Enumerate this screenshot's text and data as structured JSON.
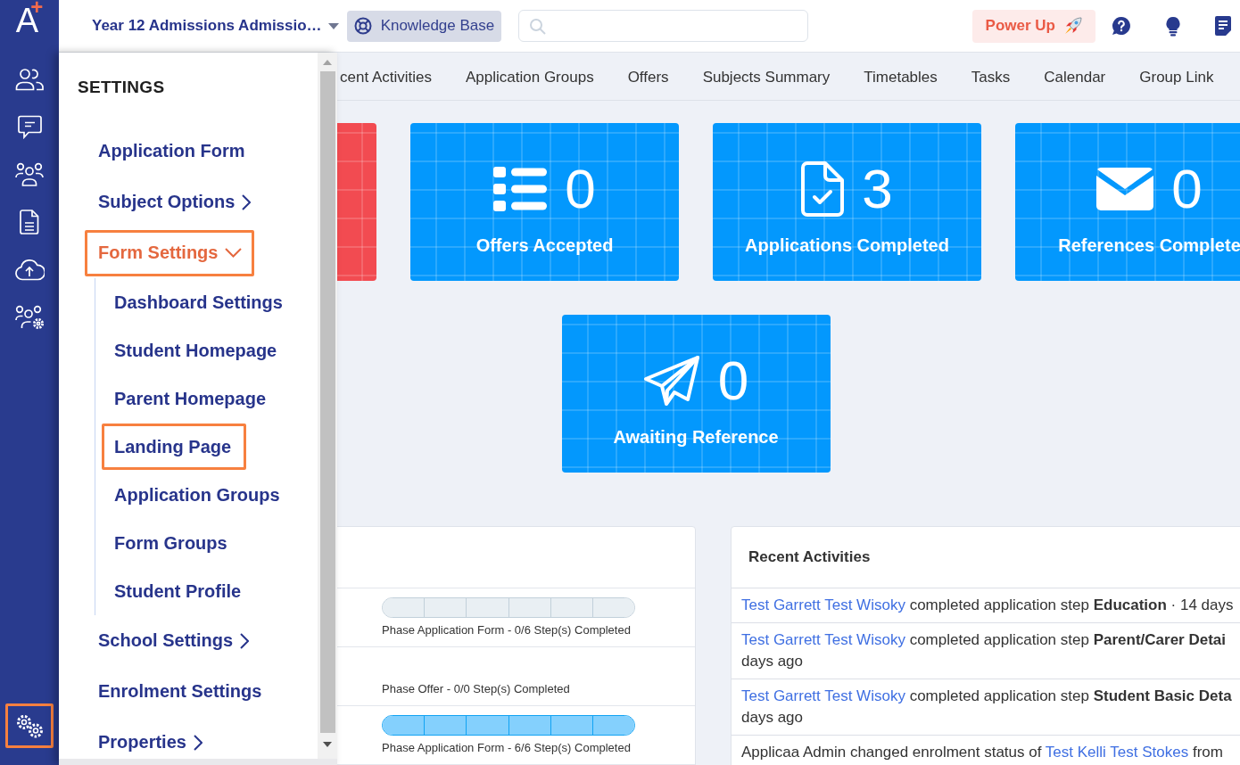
{
  "logo": {
    "letter": "A",
    "sup": "+"
  },
  "sidebar": {
    "settings_highlighted": true
  },
  "topbar": {
    "title": "Year 12 Admissions Admissio…",
    "knowledge_base": "Knowledge Base",
    "power_up": "Power Up"
  },
  "settings_menu": {
    "title": "SETTINGS",
    "items": [
      {
        "label": "Application Form",
        "has_submenu": false,
        "expanded": false,
        "highlighted": false
      },
      {
        "label": "Subject Options",
        "has_submenu": true,
        "expanded": false,
        "highlighted": false
      },
      {
        "label": "Form Settings",
        "has_submenu": true,
        "expanded": true,
        "highlighted": true,
        "children": [
          {
            "label": "Dashboard Settings",
            "highlighted": false
          },
          {
            "label": "Student Homepage",
            "highlighted": false
          },
          {
            "label": "Parent Homepage",
            "highlighted": false
          },
          {
            "label": "Landing Page",
            "highlighted": true
          },
          {
            "label": "Application Groups",
            "highlighted": false
          },
          {
            "label": "Form Groups",
            "highlighted": false
          },
          {
            "label": "Student Profile",
            "highlighted": false
          }
        ]
      },
      {
        "label": "School Settings",
        "has_submenu": true,
        "expanded": false,
        "highlighted": false
      },
      {
        "label": "Enrolment Settings",
        "has_submenu": false,
        "expanded": false,
        "highlighted": false
      },
      {
        "label": "Properties",
        "has_submenu": true,
        "expanded": false,
        "highlighted": false
      }
    ]
  },
  "tabs": [
    {
      "label": "cent Activities",
      "selected": false
    },
    {
      "label": "Application Groups",
      "selected": false
    },
    {
      "label": "Offers",
      "selected": false
    },
    {
      "label": "Subjects Summary",
      "selected": false
    },
    {
      "label": "Timetables",
      "selected": false
    },
    {
      "label": "Tasks",
      "selected": false
    },
    {
      "label": "Calendar",
      "selected": false
    },
    {
      "label": "Group Link",
      "selected": false
    }
  ],
  "stat_cards": [
    {
      "color": "#f24b51"
    },
    {
      "value": "0",
      "label": "Offers Accepted",
      "color": "#0398fd"
    },
    {
      "value": "3",
      "label": "Applications Completed",
      "color": "#0398fd"
    },
    {
      "value": "0",
      "label": "References Complete",
      "color": "#0398fd"
    },
    {
      "value": "0",
      "label": "Awaiting Reference",
      "color": "#0398fd"
    }
  ],
  "phases": {
    "rows": [
      {
        "steps": [
          {
            "done": false
          },
          {
            "done": false
          },
          {
            "done": false
          },
          {
            "done": false
          },
          {
            "done": false
          },
          {
            "done": false
          }
        ],
        "caption": "Phase Application Form - 0/6 Step(s) Completed"
      },
      {
        "caption": "Phase Offer - 0/0 Step(s) Completed"
      },
      {
        "steps": [
          {
            "done": true
          },
          {
            "done": true
          },
          {
            "done": true
          },
          {
            "done": true
          },
          {
            "done": true
          },
          {
            "done": true
          }
        ],
        "caption": "Phase Application Form - 6/6 Step(s) Completed"
      }
    ]
  },
  "recent_activities": {
    "title": "Recent Activities",
    "items": [
      {
        "lines": [
          [
            {
              "kind": "link",
              "text": "Test Garrett Test Wisoky"
            },
            {
              "kind": "text",
              "text": "completed application step **Education** · 14 days"
            }
          ]
        ]
      },
      {
        "lines": [
          [
            {
              "kind": "link",
              "text": "Test Garrett Test Wisoky"
            },
            {
              "kind": "text",
              "text": "completed application step **Parent/Carer Detai**"
            }
          ],
          [
            {
              "kind": "text",
              "text": "days ago"
            }
          ]
        ]
      },
      {
        "lines": [
          [
            {
              "kind": "link",
              "text": "Test Garrett Test Wisoky"
            },
            {
              "kind": "text",
              "text": "completed application step **Student Basic Deta**"
            }
          ],
          [
            {
              "kind": "text",
              "text": "days ago"
            }
          ]
        ]
      },
      {
        "lines": [
          [
            {
              "kind": "text",
              "text": "Applicaa Admin changed enrolment status of"
            },
            {
              "kind": "link",
              "text": "Test Kelli Test Stokes"
            },
            {
              "kind": "text",
              "text": "from"
            }
          ]
        ]
      }
    ]
  }
}
